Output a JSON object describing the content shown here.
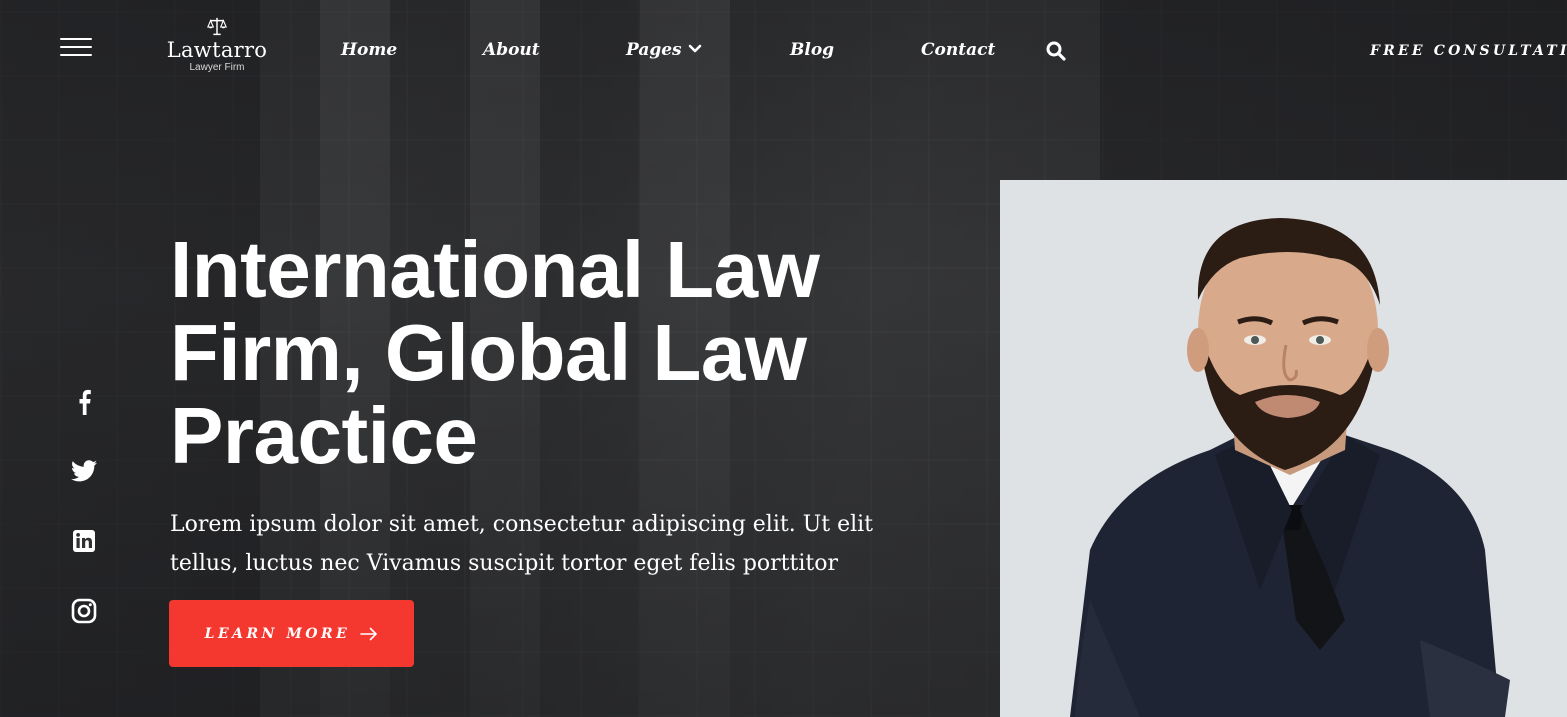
{
  "brand": {
    "name": "Lawtarro",
    "tagline": "Lawyer Firm"
  },
  "nav": {
    "items": [
      {
        "label": "Home"
      },
      {
        "label": "About"
      },
      {
        "label": "Pages",
        "has_dropdown": true
      },
      {
        "label": "Blog"
      },
      {
        "label": "Contact"
      }
    ],
    "search_icon": "search-icon",
    "menu_icon": "hamburger-icon",
    "cta_label": "FREE CONSULTATIO"
  },
  "social": {
    "icons": [
      "facebook-icon",
      "twitter-icon",
      "linkedin-icon",
      "instagram-icon"
    ]
  },
  "hero": {
    "title_lines": [
      "International Law",
      "Firm, Global Law",
      "Practice"
    ],
    "description_lines": [
      "Lorem ipsum dolor sit amet, consectetur adipiscing elit. Ut elit",
      "tellus, luctus nec Vivamus suscipit tortor eget felis porttitor"
    ],
    "button_label": "LEARN MORE"
  },
  "colors": {
    "accent": "#f5382f",
    "background": "#2e2f31",
    "portrait_bg": "#dfe2e5"
  }
}
